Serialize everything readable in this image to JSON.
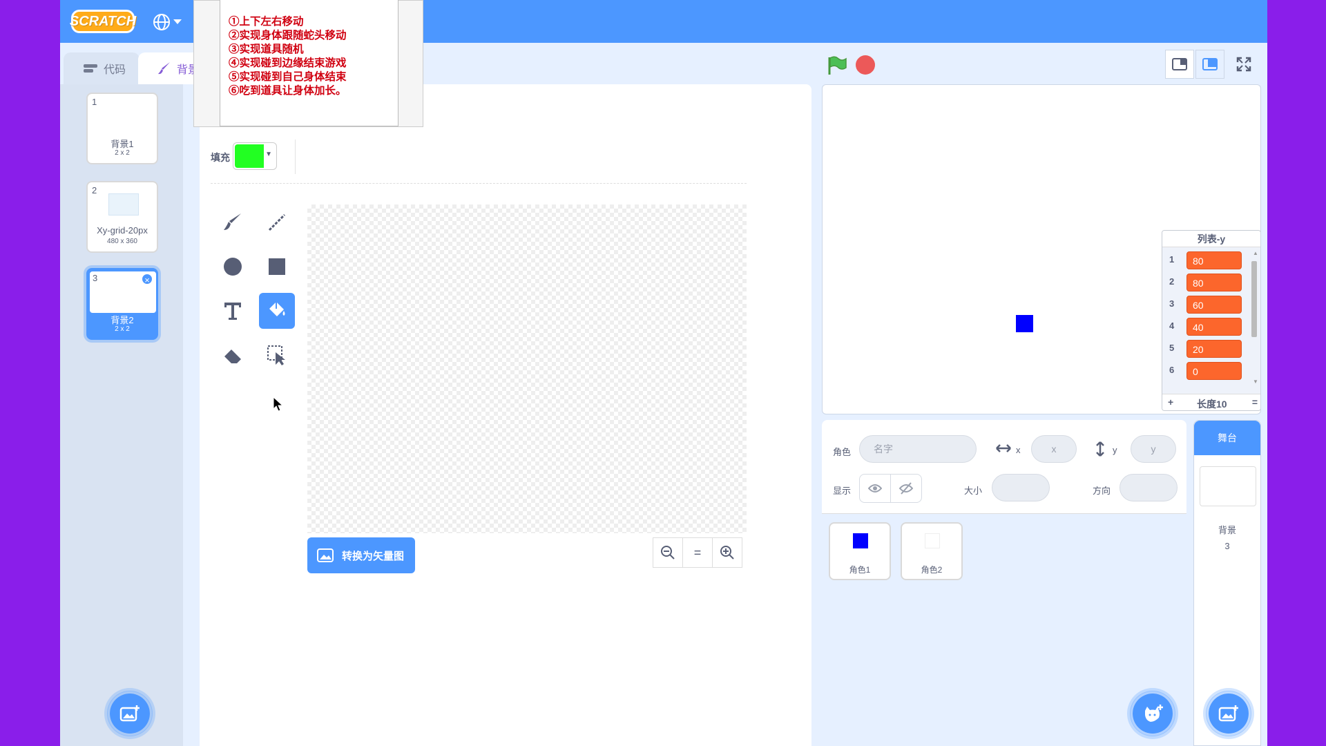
{
  "app": {
    "logo": "SCRATCH"
  },
  "note": {
    "lines": [
      "①上下左右移动",
      "②实现身体跟随蛇头移动",
      "③实现道具随机",
      "④实现碰到边缘结束游戏",
      "⑤实现碰到自己身体结束",
      "⑥吃到道具让身体加长。"
    ]
  },
  "tabs": {
    "code": "代码",
    "backdrop": "背景"
  },
  "backdrops": [
    {
      "index": "1",
      "name": "背景1",
      "size": "2 x 2"
    },
    {
      "index": "2",
      "name": "Xy-grid-20px",
      "size": "480 x 360"
    },
    {
      "index": "3",
      "name": "背景2",
      "size": "2 x 2",
      "delete": "×"
    }
  ],
  "paint": {
    "fill_label": "填充",
    "fill_color": "#22ff22",
    "convert_label": "转换为矢量图",
    "zoom_reset": "="
  },
  "list_monitor": {
    "title": "列表-y",
    "items": [
      {
        "n": "1",
        "v": "80"
      },
      {
        "n": "2",
        "v": "80"
      },
      {
        "n": "3",
        "v": "60"
      },
      {
        "n": "4",
        "v": "40"
      },
      {
        "n": "5",
        "v": "20"
      },
      {
        "n": "6",
        "v": "0"
      }
    ],
    "add": "+",
    "length_label": "长度10",
    "resize": "="
  },
  "sprite_info": {
    "sprite_label": "角色",
    "name_placeholder": "名字",
    "x_label": "x",
    "x_placeholder": "x",
    "y_label": "y",
    "y_placeholder": "y",
    "show_label": "显示",
    "size_label": "大小",
    "direction_label": "方向"
  },
  "sprites": [
    {
      "name": "角色1",
      "color": "#0000ff"
    },
    {
      "name": "角色2",
      "color": "#ffffff"
    }
  ],
  "stage_pane": {
    "tab": "舞台",
    "backdrop_label": "背景",
    "backdrop_count": "3"
  }
}
